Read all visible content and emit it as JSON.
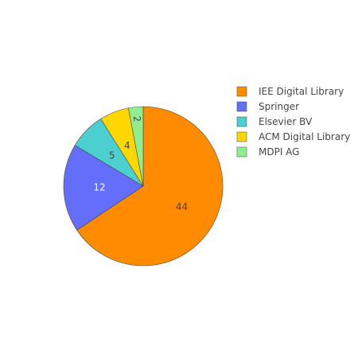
{
  "chart_data": {
    "type": "pie",
    "categories": [
      "IEE Digital Library",
      "Springer",
      "Elsevier BV",
      "ACM Digital Library",
      "MDPI AG"
    ],
    "values": [
      44,
      12,
      5,
      4,
      2
    ],
    "colors": [
      "#ff8c00",
      "#636efa",
      "#4bcfcf",
      "#ffd700",
      "#90ee90"
    ],
    "label_colors": [
      "#444444",
      "#ffffff",
      "#444444",
      "#444444",
      "#444444"
    ],
    "sort": "descending",
    "direction": "clockwise",
    "start_angle_deg": 0,
    "legend_position": "right",
    "slice_border_color": "#444444"
  }
}
